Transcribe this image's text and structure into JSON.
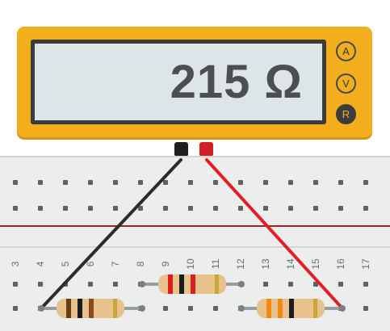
{
  "multimeter": {
    "reading": "215 Ω",
    "modes": [
      {
        "label": "A",
        "active": false
      },
      {
        "label": "V",
        "active": false
      },
      {
        "label": "R",
        "active": true
      }
    ],
    "colors": {
      "body": "#f2ae1c",
      "lcd": "#dde5e6"
    }
  },
  "breadboard": {
    "column_numbers": [
      "3",
      "4",
      "5",
      "6",
      "7",
      "8",
      "9",
      "10",
      "11",
      "12",
      "13",
      "14",
      "15",
      "16",
      "17"
    ]
  },
  "components": {
    "resistors": [
      {
        "name": "resistor-left",
        "bands": [
          "#6b3a16",
          "#1c1c1c",
          "#8b4a1c",
          "#caa53a"
        ],
        "body": "#e7c28c"
      },
      {
        "name": "resistor-middle",
        "bands": [
          "#d9201f",
          "#1c1c1c",
          "#d9201f",
          "#caa53a"
        ],
        "body": "#e7c28c"
      },
      {
        "name": "resistor-right",
        "bands": [
          "#f08a12",
          "#f08a12",
          "#1c1c1c",
          "#caa53a"
        ],
        "body": "#e7c28c"
      }
    ],
    "probe_colors": {
      "black": "#2c2c2c",
      "red": "#e02027"
    }
  }
}
